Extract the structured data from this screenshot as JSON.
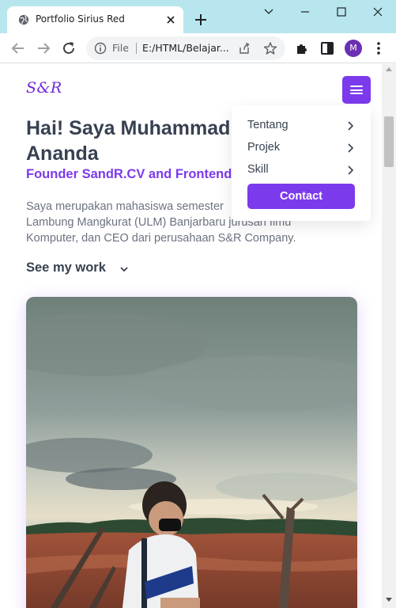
{
  "browser": {
    "tab_title": "Portfolio Sirius Red",
    "omnibox": {
      "scheme_label": "File",
      "url": "E:/HTML/Belajar..."
    },
    "profile_initial": "M"
  },
  "site": {
    "logo": "S&R",
    "hero": {
      "title_line1": "Hai! Saya Muhammad",
      "title_line2": "Ananda",
      "subtitle": "Founder SandR.CV and Frontend",
      "desc_line1": "Saya merupakan mahasiswa semester",
      "desc_line2": "Lambung Mangkurat (ULM) Banjarbaru jurusan Ilmu",
      "desc_line3": "Komputer, dan CEO dari perusahaan S&R Company.",
      "see_work": "See my work"
    },
    "menu": {
      "items": [
        {
          "label": "Tentang"
        },
        {
          "label": "Projek"
        },
        {
          "label": "Skill"
        }
      ],
      "contact": "Contact"
    }
  },
  "colors": {
    "brand": "#7c3aed",
    "titlebar": "#b7e6ee",
    "heading": "#374151",
    "body_text": "#6b7280"
  }
}
